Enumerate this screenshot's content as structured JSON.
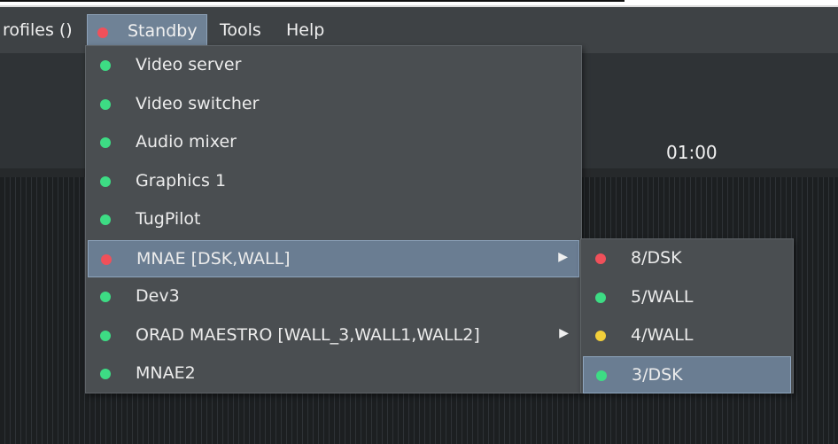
{
  "menubar": {
    "profiles_label": "rofiles ()",
    "standby_label": "Standby",
    "tools_label": "Tools",
    "help_label": "Help"
  },
  "clock": "01:00",
  "status_colors": {
    "green": "#3ddc84",
    "red": "#f0505a",
    "yellow": "#f2cf3a"
  },
  "standby_menu": [
    {
      "label": "Video server",
      "status": "green",
      "submenu": false
    },
    {
      "label": "Video switcher",
      "status": "green",
      "submenu": false
    },
    {
      "label": "Audio mixer",
      "status": "green",
      "submenu": false
    },
    {
      "label": "Graphics 1",
      "status": "green",
      "submenu": false
    },
    {
      "label": "TugPilot",
      "status": "green",
      "submenu": false
    },
    {
      "label": "MNAE [DSK,WALL]",
      "status": "red",
      "submenu": true,
      "highlighted": true
    },
    {
      "label": "Dev3",
      "status": "green",
      "submenu": false
    },
    {
      "label": "ORAD MAESTRO [WALL_3,WALL1,WALL2]",
      "status": "green",
      "submenu": true
    },
    {
      "label": "MNAE2",
      "status": "green",
      "submenu": false
    }
  ],
  "mnae_submenu": [
    {
      "label": "8/DSK",
      "status": "red"
    },
    {
      "label": "5/WALL",
      "status": "green"
    },
    {
      "label": "4/WALL",
      "status": "yellow"
    },
    {
      "label": "3/DSK",
      "status": "green",
      "highlighted": true
    }
  ]
}
